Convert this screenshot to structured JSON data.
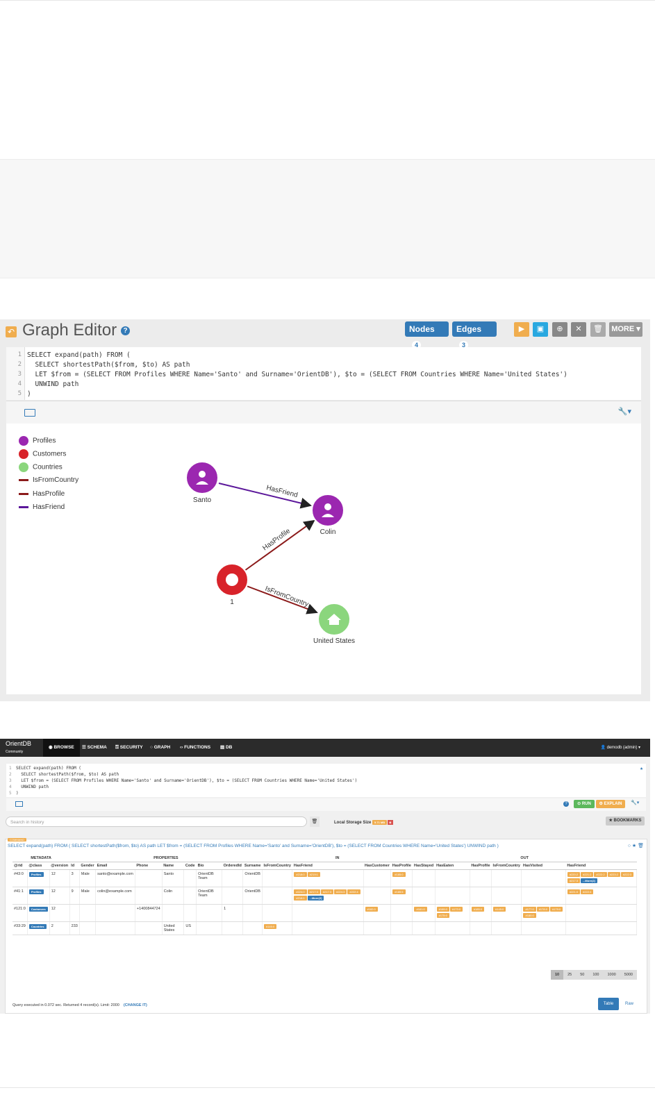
{
  "graph_editor": {
    "title": "Graph Editor",
    "nodes_label": "Nodes",
    "nodes_count": "4",
    "edges_label": "Edges",
    "edges_count": "3",
    "more_label": "MORE",
    "code_lines": [
      {
        "n": "1",
        "text": "SELECT expand(path) FROM ("
      },
      {
        "n": "2",
        "text": "  SELECT shortestPath($from, $to) AS path"
      },
      {
        "n": "3",
        "text": "  LET $from = (SELECT FROM Profiles WHERE Name='Santo' and Surname='OrientDB'), $to = (SELECT FROM Countries WHERE Name='United States')"
      },
      {
        "n": "4",
        "text": "  UNWIND path"
      },
      {
        "n": "5",
        "text": ")"
      }
    ],
    "legend": [
      {
        "label": "Profiles",
        "color": "#9b27b0"
      },
      {
        "label": "Customers",
        "color": "#d8232a"
      },
      {
        "label": "Countries",
        "color": "#8bd67d"
      },
      {
        "label": "IsFromCountry",
        "color": "#8b1a1a"
      },
      {
        "label": "HasProfile",
        "color": "#8b1a1a"
      },
      {
        "label": "HasFriend",
        "color": "#5b179a"
      }
    ],
    "nodes": {
      "santo": "Santo",
      "colin": "Colin",
      "one": "1",
      "us": "United States"
    },
    "edges": {
      "hasfriend": "HasFriend",
      "hasprofile": "HasProfile",
      "isfromcountry": "IsFromCountry"
    }
  },
  "studio": {
    "logo": "OrientDB",
    "logo_sub": "Community",
    "nav": [
      "BROWSE",
      "SCHEMA",
      "SECURITY",
      "GRAPH",
      "FUNCTIONS",
      "DB"
    ],
    "user": "demodb (admin)",
    "code_lines": [
      {
        "n": "1",
        "text": "SELECT expand(path) FROM ("
      },
      {
        "n": "2",
        "text": "  SELECT shortestPath($from, $to) AS path"
      },
      {
        "n": "3",
        "text": "  LET $from = (SELECT FROM Profiles WHERE Name='Santo' and Surname='OrientDB'), $to = (SELECT FROM Countries WHERE Name='United States')"
      },
      {
        "n": "4",
        "text": "  UNWIND path"
      },
      {
        "n": "5",
        "text": ")"
      }
    ],
    "run_label": "RUN",
    "explain_label": "EXPLAIN",
    "search_placeholder": "Search in history",
    "local_storage_label": "Local Storage Size",
    "local_storage_value": "5.71 MB",
    "bookmarks_label": "BOOKMARKS",
    "command_badge": "COMMAND",
    "query_text": "SELECT expand(path) FROM ( SELECT shortestPath($from, $to) AS path LET $from = (SELECT FROM Profiles WHERE Name='Santo' and Surname='OrientDB'), $to = (SELECT FROM Countries WHERE Name='United States') UNWIND path )",
    "groups": {
      "metadata": "METADATA",
      "properties": "PROPERTIES",
      "in": "IN",
      "out": "OUT"
    },
    "columns": [
      "@rid",
      "@class",
      "@version",
      "Id",
      "Gender",
      "Email",
      "Phone",
      "Name",
      "Code",
      "Bio",
      "OrderedId",
      "Surname",
      "IsFromCountry",
      "HasFriend",
      "HasCustomer",
      "HasProfile",
      "HasStayed",
      "HasEaten",
      "HasProfile",
      "IsFromCountry",
      "HasVisited",
      "HasFriend"
    ],
    "rows": [
      {
        "rid": "#43:0",
        "cls": "Profiles",
        "ver": "12",
        "id": "3",
        "gender": "Male",
        "email": "santo@example.com",
        "phone": "",
        "name": "Santo",
        "code": "",
        "bio": "OrientDB Team",
        "ordered": "",
        "surname": "OrientDB",
        "in_isfrom": [],
        "in_hasfriend": [
          "#218:0",
          "#219:1"
        ],
        "in_hascustomer": [],
        "in_hasprofile": [
          "#185:0"
        ],
        "out_hasstayed": [],
        "out_haseaten": [],
        "out_hasprofile": [],
        "out_isfrom": [],
        "out_hasvisited": [],
        "out_hasfriend": [
          "#220:2",
          "#221:2",
          "#222:2",
          "#223:2",
          "#222:3",
          "#217:3"
        ],
        "out_more": "...More(2)"
      },
      {
        "rid": "#41:1",
        "cls": "Profiles",
        "ver": "12",
        "id": "9",
        "gender": "Male",
        "email": "colin@example.com",
        "phone": "",
        "name": "Colin",
        "code": "",
        "bio": "OrientDB Team",
        "ordered": "",
        "surname": "OrientDB",
        "in_isfrom": [],
        "in_hasfriend": [
          "#224:0",
          "#217:3",
          "#217:3",
          "#224:3",
          "#222:4",
          "#218:1"
        ],
        "in_more": "...More(2)",
        "in_hascustomer": [],
        "in_hasprofile": [
          "#185:5"
        ],
        "out_hasstayed": [],
        "out_haseaten": [],
        "out_hasprofile": [],
        "out_isfrom": [],
        "out_hasvisited": [],
        "out_hasfriend": [
          "#221:0",
          "#222:4"
        ]
      },
      {
        "rid": "#121:0",
        "cls": "Customers",
        "ver": "12",
        "id": "",
        "gender": "",
        "email": "",
        "phone": "+1400844724",
        "name": "",
        "code": "",
        "bio": "",
        "ordered": "1",
        "surname": "",
        "in_isfrom": [],
        "in_hasfriend": [],
        "in_hascustomer": [
          "#182:0"
        ],
        "in_hasprofile": [],
        "out_hasstayed": [
          "#161:0"
        ],
        "out_haseaten": [
          "#169:0",
          "#173:0",
          "#175:0"
        ],
        "out_hasprofile": [
          "#185:0"
        ],
        "out_isfrom": [
          "#145:0"
        ],
        "out_hasvisited": [
          "#177:0",
          "#178:0",
          "#179:0",
          "#180:0"
        ],
        "out_hasfriend": []
      },
      {
        "rid": "#33:29",
        "cls": "Countries",
        "ver": "2",
        "id": "233",
        "gender": "",
        "email": "",
        "phone": "",
        "name": "United States",
        "code": "US",
        "bio": "",
        "ordered": "",
        "surname": "",
        "in_isfrom": [
          "#145:0"
        ],
        "in_hasfriend": [],
        "in_hascustomer": [],
        "in_hasprofile": [],
        "out_hasstayed": [],
        "out_haseaten": [],
        "out_hasprofile": [],
        "out_isfrom": [],
        "out_hasvisited": [],
        "out_hasfriend": []
      }
    ],
    "page_sizes": [
      "10",
      "25",
      "50",
      "100",
      "1000",
      "5000"
    ],
    "status_text": "Query executed in 0.072 sec. Returned 4 record(s). Limit: 2000",
    "change_it": "(CHANGE IT)",
    "table_tab": "Table",
    "raw_tab": "Raw"
  }
}
